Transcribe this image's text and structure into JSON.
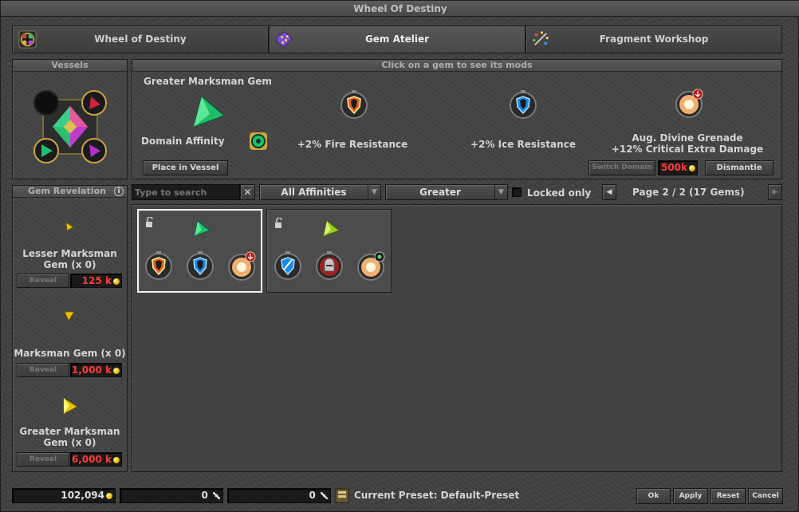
{
  "window": {
    "title": "Wheel Of Destiny"
  },
  "tabs": [
    {
      "label": "Wheel of Destiny",
      "icon": "wheel-icon"
    },
    {
      "label": "Gem Atelier",
      "icon": "gem-bag-icon"
    },
    {
      "label": "Fragment Workshop",
      "icon": "fragment-icon"
    }
  ],
  "vessels": {
    "header": "Vessels"
  },
  "gem_detail": {
    "header": "Click on a gem to see its mods",
    "gem_name": "Greater Marksman Gem",
    "affinity_label": "Domain Affinity",
    "place_button": "Place in Vessel",
    "mods": [
      {
        "label": "+2% Fire Resistance",
        "icon": "fire-resistance-shield-icon"
      },
      {
        "label": "+2% Ice Resistance",
        "icon": "ice-resistance-shield-icon"
      },
      {
        "label_line1": "Aug. Divine Grenade",
        "label_line2": "+12% Critical Extra Damage",
        "icon": "divine-grenade-icon"
      }
    ],
    "switch_domain_button": "Switch Domain",
    "switch_cost": "500k",
    "dismantle_button": "Dismantle"
  },
  "revelation": {
    "header": "Gem Revelation",
    "info_glyph": "i",
    "reveal_label": "Reveal",
    "gems": [
      {
        "name_line1": "Lesser Marksman",
        "name_line2": "Gem (x 0)",
        "cost": "125 k"
      },
      {
        "name_line1": "Marksman Gem (x 0)",
        "name_line2": "",
        "cost": "1,000 k"
      },
      {
        "name_line1": "Greater Marksman",
        "name_line2": "Gem (x 0)",
        "cost": "6,000 k"
      }
    ]
  },
  "filters": {
    "search_placeholder": "Type to search",
    "clear_glyph": "✕",
    "affinity": "All Affinities",
    "quality": "Greater",
    "locked_label": "Locked only",
    "page_info": "Page 2 / 2 (17 Gems)"
  },
  "footer": {
    "gold": "102,094",
    "fragments1": "0",
    "fragments2": "0",
    "preset": "Current Preset: Default-Preset",
    "ok": "Ok",
    "apply": "Apply",
    "reset": "Reset",
    "cancel": "Cancel"
  },
  "colors": {
    "gem_green": "#1fbf6a",
    "gem_lime": "#9cd020",
    "gem_yellow": "#e8c400",
    "cost_red": "#ff3b3b",
    "selected_border": "#f2f2f2"
  }
}
